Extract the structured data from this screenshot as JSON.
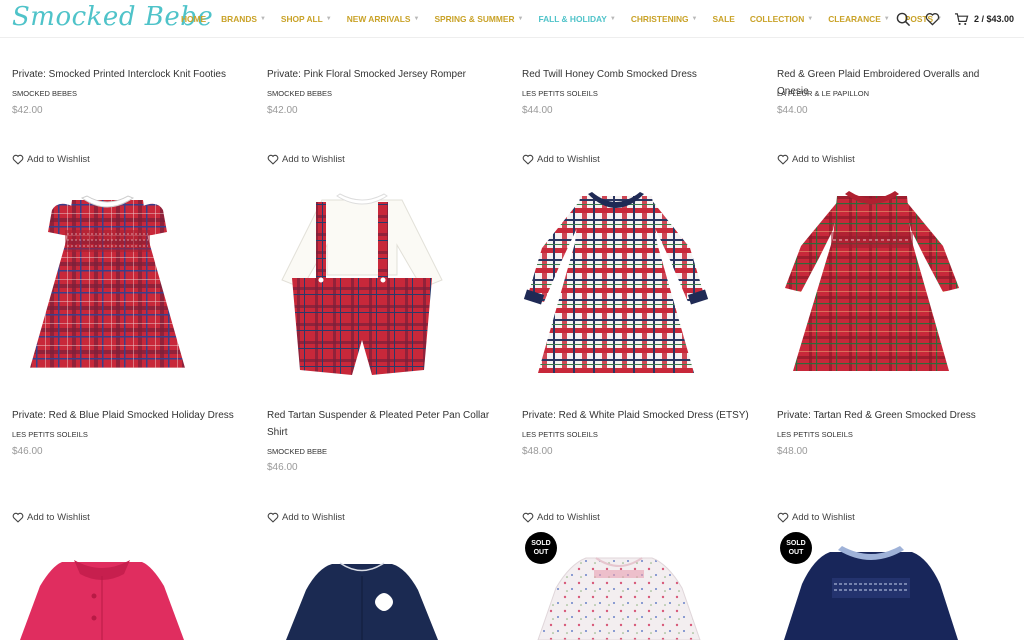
{
  "header": {
    "logo": "Smocked Bebe",
    "nav": [
      {
        "label": "HOME",
        "caret": false
      },
      {
        "label": "BRANDS",
        "caret": true
      },
      {
        "label": "SHOP ALL",
        "caret": true
      },
      {
        "label": "NEW ARRIVALS",
        "caret": true
      },
      {
        "label": "SPRING & SUMMER",
        "caret": true
      },
      {
        "label": "FALL & HOLIDAY",
        "caret": true
      },
      {
        "label": "CHRISTENING",
        "caret": true
      },
      {
        "label": "SALE",
        "caret": false
      },
      {
        "label": "COLLECTION",
        "caret": true
      },
      {
        "label": "CLEARANCE",
        "caret": true
      },
      {
        "label": "POSTS",
        "caret": true
      }
    ],
    "cart": "2 / $43.00"
  },
  "wishlist_label": "Add to Wishlist",
  "sold_out_label": "SOLD OUT",
  "row1": [
    {
      "title": "Private: Smocked Printed Interclock Knit Footies",
      "brand": "SMOCKED BEBES",
      "price": "$42.00"
    },
    {
      "title": "Private: Pink Floral Smocked Jersey Romper",
      "brand": "SMOCKED BEBES",
      "price": "$42.00"
    },
    {
      "title": "Red Twill Honey Comb Smocked Dress",
      "brand": "LES PETITS SOLEILS",
      "price": "$44.00"
    },
    {
      "title": "Red & Green Plaid Embroidered Overalls and Onesie",
      "brand": "LA FLEUR & LE PAPILLON",
      "price": "$44.00"
    }
  ],
  "row2": [
    {
      "title": "Private: Red & Blue Plaid Smocked Holiday Dress",
      "brand": "LES PETITS SOLEILS",
      "price": "$46.00"
    },
    {
      "title": "Red Tartan Suspender & Pleated Peter Pan Collar Shirt",
      "brand": "SMOCKED BEBE",
      "price": "$46.00"
    },
    {
      "title": "Private: Red & White Plaid Smocked Dress (ETSY)",
      "brand": "LES PETITS SOLEILS",
      "price": "$48.00"
    },
    {
      "title": "Private: Tartan Red & Green Smocked Dress",
      "brand": "LES PETITS SOLEILS",
      "price": "$48.00"
    }
  ],
  "colors": {
    "logo": "#4fc3c9",
    "nav": "#c9a227",
    "nav_active": "#4fc3c9",
    "price": "#999999",
    "tartan_red": "#c8283a"
  },
  "icons": [
    "search-icon",
    "heart-icon",
    "cart-icon",
    "heart-outline-icon"
  ]
}
